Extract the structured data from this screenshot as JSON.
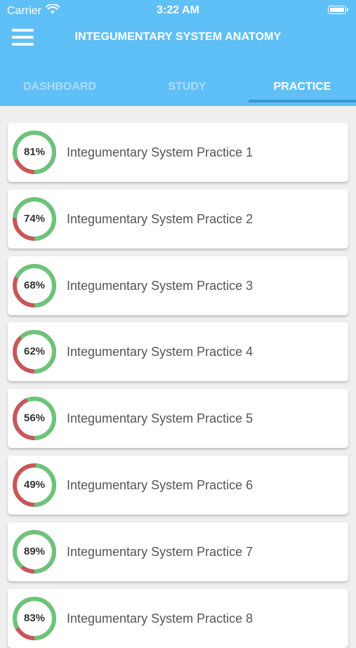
{
  "status_bar": {
    "carrier": "Carrier",
    "time": "3:22 AM"
  },
  "header": {
    "title": "INTEGUMENTARY SYSTEM ANATOMY"
  },
  "tabs": [
    {
      "label": "DASHBOARD",
      "active": false
    },
    {
      "label": "STUDY",
      "active": false
    },
    {
      "label": "PRACTICE",
      "active": true
    }
  ],
  "colors": {
    "header": "#5fc0f8",
    "correct": "#6cc47a",
    "incorrect": "#c8575a",
    "indicator": "#3c92d2"
  },
  "practice_items": [
    {
      "percent_label": "81%",
      "percent": 81,
      "title": "Integumentary System Practice 1"
    },
    {
      "percent_label": "74%",
      "percent": 74,
      "title": "Integumentary System Practice 2"
    },
    {
      "percent_label": "68%",
      "percent": 68,
      "title": "Integumentary System Practice 3"
    },
    {
      "percent_label": "62%",
      "percent": 62,
      "title": "Integumentary System Practice 4"
    },
    {
      "percent_label": "56%",
      "percent": 56,
      "title": "Integumentary System Practice 5"
    },
    {
      "percent_label": "49%",
      "percent": 49,
      "title": "Integumentary System Practice 6"
    },
    {
      "percent_label": "89%",
      "percent": 89,
      "title": "Integumentary System Practice 7"
    },
    {
      "percent_label": "83%",
      "percent": 83,
      "title": "Integumentary System Practice 8"
    }
  ]
}
